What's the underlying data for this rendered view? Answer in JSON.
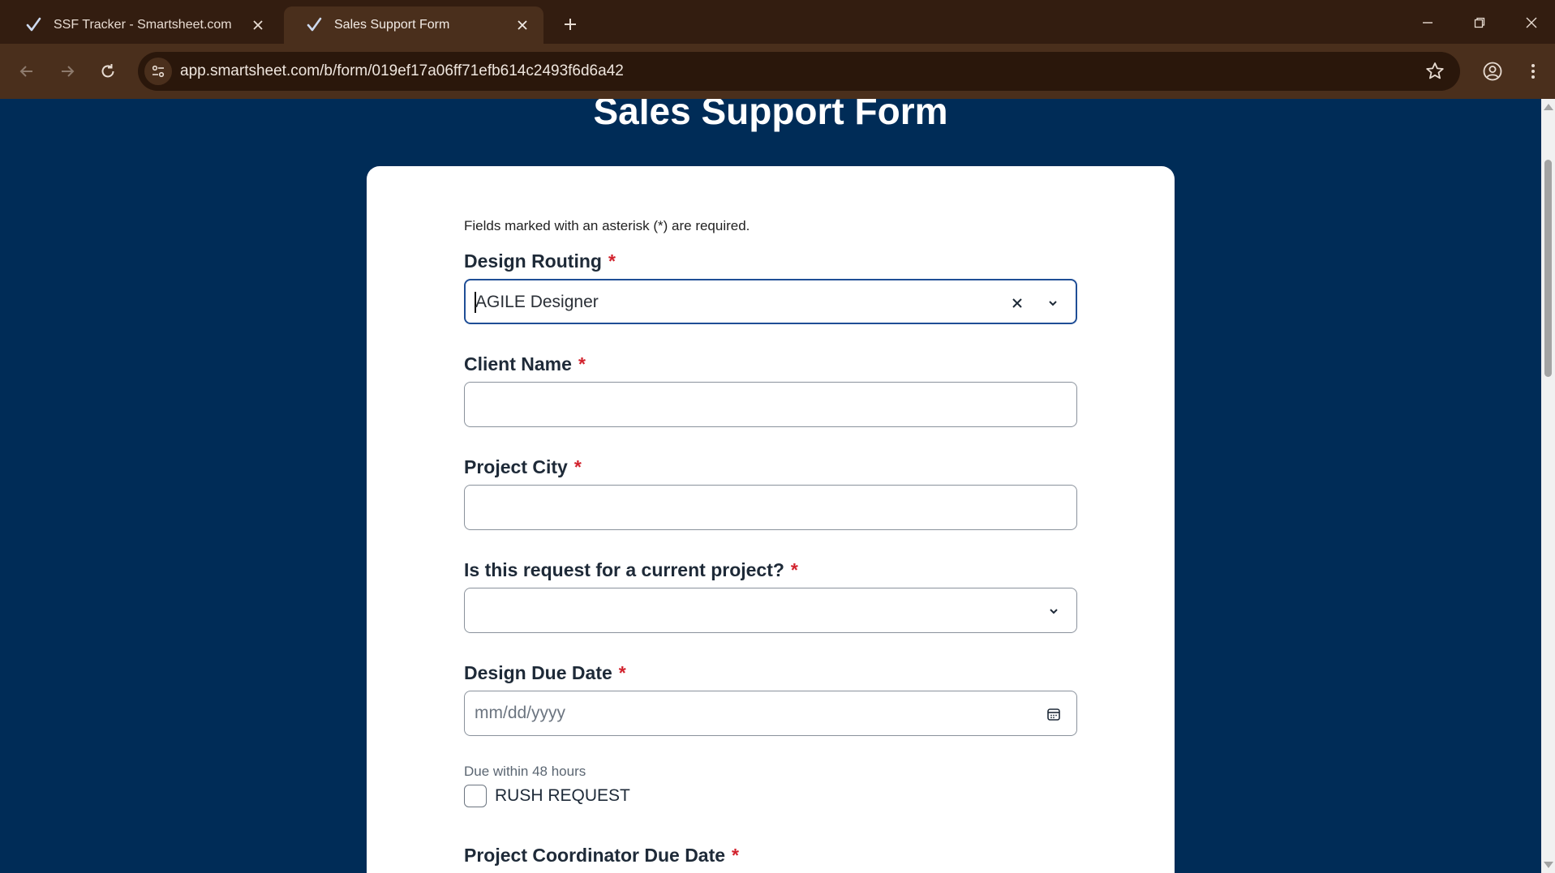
{
  "browser": {
    "tabs": [
      {
        "title": "SSF Tracker - Smartsheet.com",
        "active": false
      },
      {
        "title": "Sales Support Form",
        "active": true
      }
    ],
    "url": "app.smartsheet.com/b/form/019ef17a06ff71efb614c2493f6d6a42"
  },
  "form": {
    "title": "Sales Support Form",
    "required_note": "Fields marked with an asterisk (*) are required.",
    "required_marker": "*",
    "fields": {
      "design_routing": {
        "label": "Design Routing",
        "value": "AGILE Designer"
      },
      "client_name": {
        "label": "Client Name",
        "value": ""
      },
      "project_city": {
        "label": "Project City",
        "value": ""
      },
      "current_project": {
        "label": "Is this request for a current project?",
        "value": ""
      },
      "design_due_date": {
        "label": "Design Due Date",
        "placeholder": "mm/dd/yyyy",
        "helper": "Due within 48 hours"
      },
      "rush_request": {
        "label": "RUSH REQUEST",
        "checked": false
      },
      "coordinator_due_date": {
        "label": "Project Coordinator Due Date"
      }
    }
  },
  "colors": {
    "page_background": "#002c57",
    "focus_border": "#1f4e96",
    "required": "#d2222d",
    "chrome_dark": "#331d10",
    "chrome_toolbar": "#4a2f1c"
  }
}
